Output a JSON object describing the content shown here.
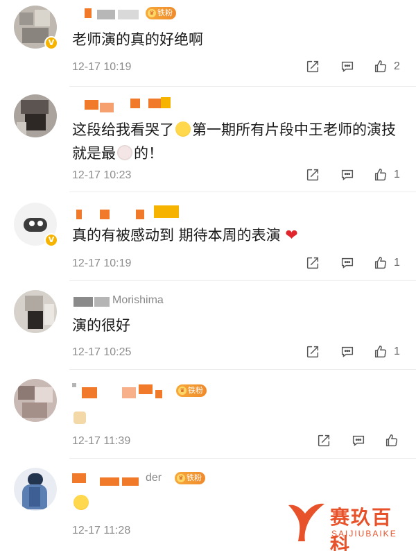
{
  "comments": [
    {
      "fan_label": "铁粉",
      "text": "老师演的真的好绝啊",
      "time": "12-17 10:19",
      "likes": "2"
    },
    {
      "text_part1": "这段给我看哭了",
      "text_part2": "第一期所有片段中王老师的演技就是最",
      "text_part3": "的！",
      "time": "12-17 10:23",
      "likes": "1"
    },
    {
      "text": "真的有被感动到 期待本周的表演",
      "time": "12-17 10:19",
      "likes": "1"
    },
    {
      "name_visible": "Morishima",
      "text": "演的很好",
      "time": "12-17 10:25",
      "likes": "1"
    },
    {
      "fan_label": "铁粉",
      "time": "12-17 11:39"
    },
    {
      "name_visible": "der",
      "fan_label": "铁粉",
      "time": "12-17 11:28"
    }
  ],
  "icons": {
    "share": "share-icon",
    "comment": "comment-icon",
    "like": "thumbs-up-icon"
  },
  "watermark": {
    "title": "赛玖百科",
    "subtitle": "SAIJIUBAIKE"
  },
  "colors": {
    "accent": "#e8522a",
    "badge": "#f6b400",
    "heart": "#e0252c"
  }
}
